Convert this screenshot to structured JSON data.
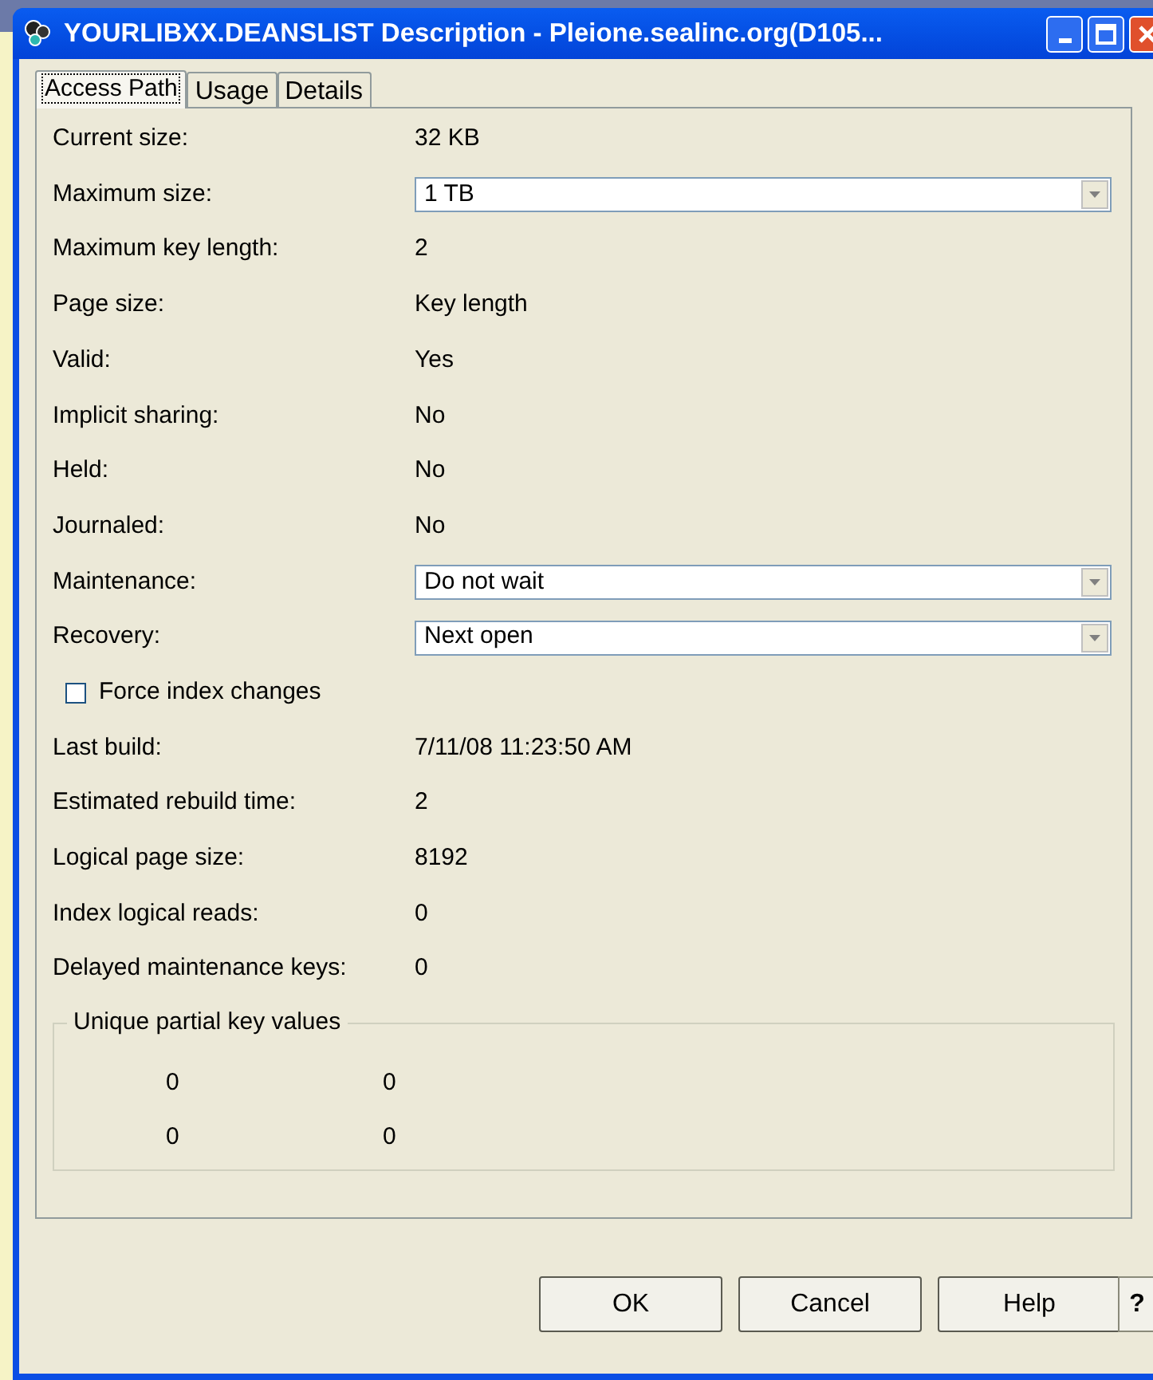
{
  "window": {
    "title": "YOURLIBXX.DEANSLIST Description - Pleione.sealinc.org(D105..."
  },
  "tabs": [
    {
      "label": "Access Path",
      "selected": true
    },
    {
      "label": "Usage",
      "selected": false
    },
    {
      "label": "Details",
      "selected": false
    }
  ],
  "fields": [
    {
      "kind": "text",
      "label": "Current size:",
      "value": "32 KB"
    },
    {
      "kind": "dropdown",
      "label": "Maximum size:",
      "value": "1 TB"
    },
    {
      "kind": "text",
      "label": "Maximum key length:",
      "value": "2"
    },
    {
      "kind": "text",
      "label": "Page size:",
      "value": "Key length"
    },
    {
      "kind": "text",
      "label": "Valid:",
      "value": "Yes"
    },
    {
      "kind": "text",
      "label": "Implicit sharing:",
      "value": "No"
    },
    {
      "kind": "text",
      "label": "Held:",
      "value": "No"
    },
    {
      "kind": "text",
      "label": "Journaled:",
      "value": "No"
    },
    {
      "kind": "dropdown",
      "label": "Maintenance:",
      "value": "Do not wait"
    },
    {
      "kind": "dropdown",
      "label": "Recovery:",
      "value": "Next open"
    },
    {
      "kind": "checkbox",
      "label": "Force index changes",
      "checked": false
    },
    {
      "kind": "text",
      "label": "Last build:",
      "value": "7/11/08 11:23:50 AM"
    },
    {
      "kind": "text",
      "label": "Estimated rebuild time:",
      "value": "2"
    },
    {
      "kind": "text",
      "label": "Logical page size:",
      "value": "8192"
    },
    {
      "kind": "text",
      "label": "Index logical reads:",
      "value": "0"
    },
    {
      "kind": "text",
      "label": "Delayed maintenance keys:",
      "value": "0"
    }
  ],
  "group": {
    "title": "Unique partial key values",
    "rows": [
      [
        "0",
        "0"
      ],
      [
        "0",
        "0"
      ]
    ]
  },
  "buttons": [
    {
      "kind": "text",
      "label": "OK"
    },
    {
      "kind": "text",
      "label": "Cancel"
    },
    {
      "kind": "text",
      "label": "Help"
    },
    {
      "kind": "icon",
      "label": "?"
    }
  ]
}
